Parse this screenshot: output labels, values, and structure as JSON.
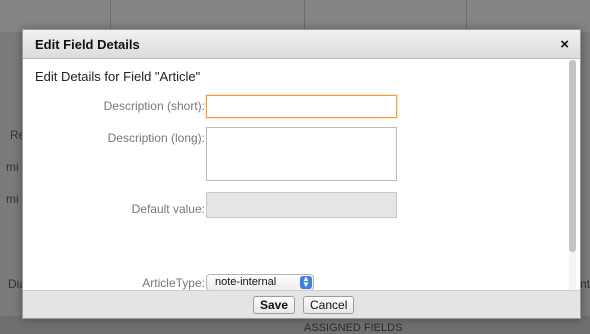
{
  "background": {
    "fragments": [
      "Re",
      "mi",
      "mi",
      "Dia",
      "nt"
    ],
    "assigned_fields": "ASSIGNED FIELDS"
  },
  "dialog": {
    "title": "Edit Field Details",
    "close_icon": "×",
    "subtitle": "Edit Details for Field \"Article\"",
    "fields": {
      "description_short": {
        "label": "Description (short):",
        "value": ""
      },
      "description_long": {
        "label": "Description (long):",
        "value": ""
      },
      "default_value": {
        "label": "Default value:",
        "value": ""
      },
      "article_type": {
        "label": "ArticleType:",
        "selected": "note-internal"
      }
    },
    "buttons": {
      "save": "Save",
      "cancel": "Cancel"
    }
  },
  "colors": {
    "focus_border": "#f0a040",
    "select_arrow": "#3b82e0"
  }
}
